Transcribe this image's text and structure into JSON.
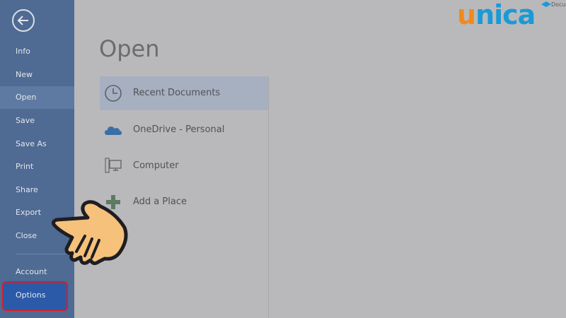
{
  "sidebar": {
    "items": [
      {
        "label": "Info"
      },
      {
        "label": "New"
      },
      {
        "label": "Open"
      },
      {
        "label": "Save"
      },
      {
        "label": "Save As"
      },
      {
        "label": "Print"
      },
      {
        "label": "Share"
      },
      {
        "label": "Export"
      },
      {
        "label": "Close"
      },
      {
        "label": "Account"
      },
      {
        "label": "Options"
      }
    ]
  },
  "main": {
    "title": "Open",
    "places": [
      {
        "label": "Recent Documents",
        "icon": "clock-icon"
      },
      {
        "label": "OneDrive - Personal",
        "icon": "cloud-icon"
      },
      {
        "label": "Computer",
        "icon": "computer-icon"
      },
      {
        "label": "Add a Place",
        "icon": "plus-icon"
      }
    ]
  },
  "logo": {
    "u": "u",
    "rest": "nica"
  },
  "header": {
    "doc_hint": "Docu"
  },
  "colors": {
    "sidebar": "#4f6a93",
    "options_highlight_border": "#cf2030",
    "logo_orange": "#f08a1c",
    "logo_blue": "#1a9ad6"
  }
}
